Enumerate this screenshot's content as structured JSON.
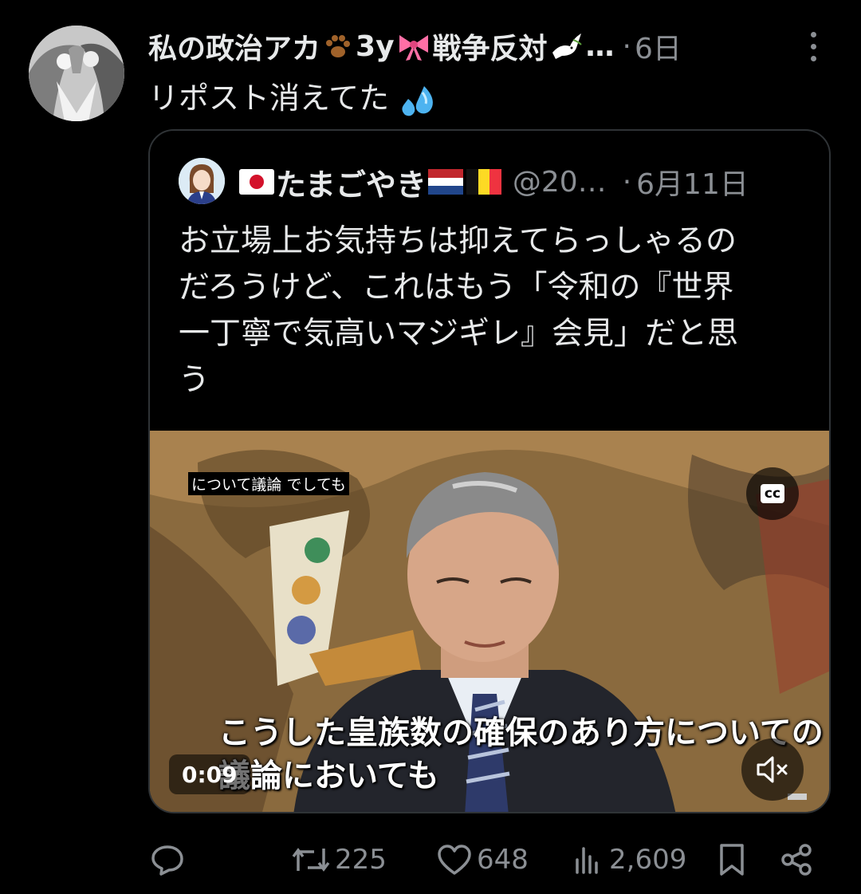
{
  "post": {
    "author": "私の政治アカ",
    "author_suffix": "3y",
    "author_tail": "戦争反対",
    "ellipsis": "…",
    "separator": "·",
    "time": "6日",
    "text": "リポスト消えてた"
  },
  "quoted": {
    "name": "たまごやき",
    "handle": "@20…",
    "separator": "·",
    "date": "6月11日",
    "text": "お立場上お気持ちは抑えてらっしゃるの\nだろうけど、これはもう「令和の『世界\n一丁寧で気高いマジギレ』会見」だと思\nう"
  },
  "video": {
    "caption_top": "について議論 でしても",
    "cc_label": "cc",
    "subtitle": "こうした皇族数の確保のあり方についての\n議論においても",
    "timestamp": "0:09"
  },
  "actions": {
    "reposts": "225",
    "likes": "648",
    "views": "2,609"
  },
  "icons": [
    "paw-icon",
    "ribbon-icon",
    "dove-icon",
    "sweat-drops-icon",
    "japan-flag-icon",
    "netherlands-flag-icon",
    "belgium-flag-icon",
    "reply-icon",
    "repost-icon",
    "like-icon",
    "views-icon",
    "bookmark-icon",
    "share-icon",
    "more-icon",
    "cc-icon",
    "mute-icon"
  ],
  "colors": {
    "background": "#000000",
    "text": "#e7e9ea",
    "muted": "#8b8f94",
    "border": "#2f3336"
  }
}
